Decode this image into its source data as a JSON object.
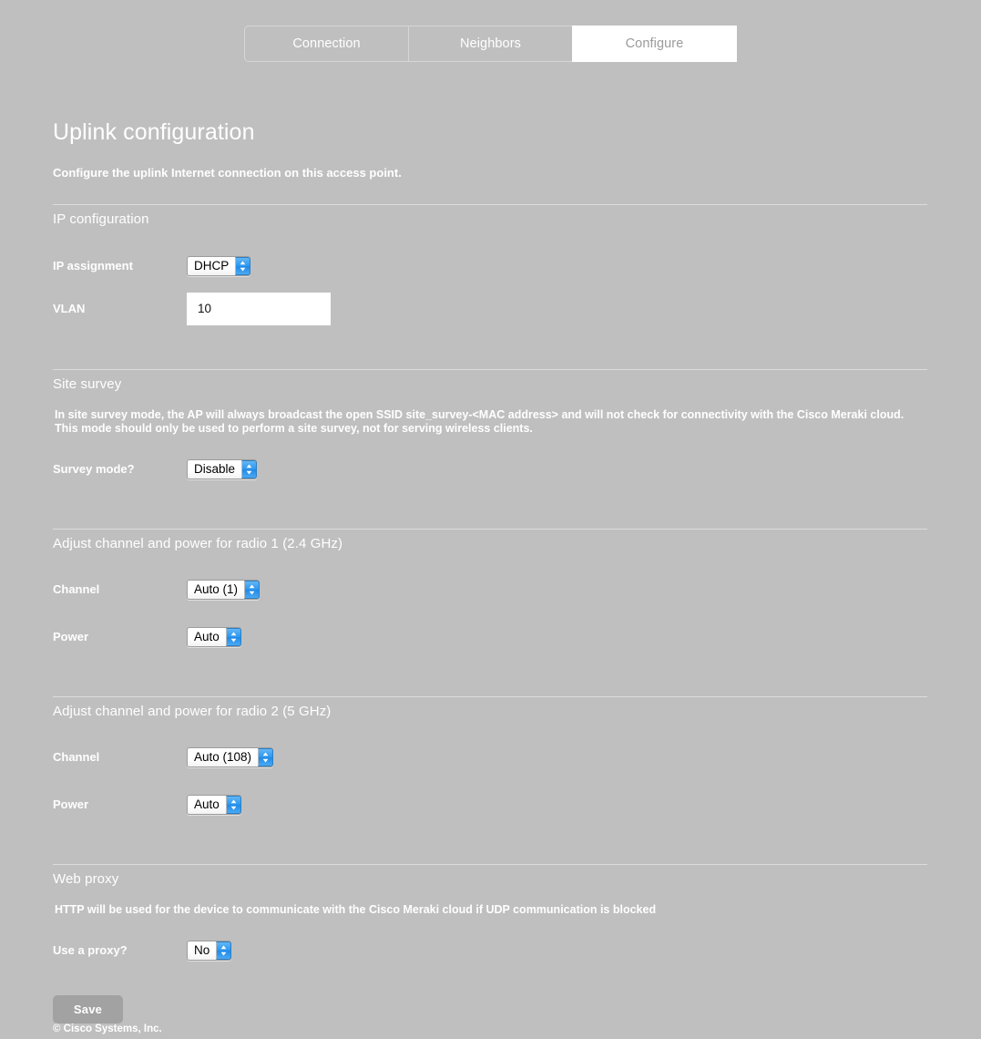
{
  "tabs": [
    {
      "label": "Connection",
      "active": false
    },
    {
      "label": "Neighbors",
      "active": false
    },
    {
      "label": "Configure",
      "active": true
    }
  ],
  "page": {
    "title": "Uplink configuration",
    "subtitle": "Configure the uplink Internet connection on this access point."
  },
  "sections": {
    "ip": {
      "heading": "IP configuration",
      "ip_assignment_label": "IP assignment",
      "ip_assignment_value": "DHCP",
      "vlan_label": "VLAN",
      "vlan_value": "10"
    },
    "survey": {
      "heading": "Site survey",
      "description": "In site survey mode, the AP will always broadcast the open SSID site_survey-<MAC address> and will not check for connectivity with the Cisco Meraki cloud. This mode should only be used to perform a site survey, not for serving wireless clients.",
      "mode_label": "Survey mode?",
      "mode_value": "Disable"
    },
    "radio1": {
      "heading": "Adjust channel and power for radio 1 (2.4 GHz)",
      "channel_label": "Channel",
      "channel_value": "Auto (1)",
      "power_label": "Power",
      "power_value": "Auto"
    },
    "radio2": {
      "heading": "Adjust channel and power for radio 2 (5 GHz)",
      "channel_label": "Channel",
      "channel_value": "Auto (108)",
      "power_label": "Power",
      "power_value": "Auto"
    },
    "proxy": {
      "heading": "Web proxy",
      "description": "HTTP will be used for the device to communicate with the Cisco Meraki cloud if UDP communication is blocked",
      "use_proxy_label": "Use a proxy?",
      "use_proxy_value": "No"
    }
  },
  "actions": {
    "save_label": "Save"
  },
  "footer": {
    "copyright": "© Cisco Systems, Inc."
  },
  "colors": {
    "background": "#bfbfbf",
    "text": "#ffffff",
    "active_tab_bg": "#ffffff",
    "active_tab_text": "#9a9a9a",
    "stepper_blue": "#2b96ef",
    "save_button": "#a2a2a2"
  }
}
